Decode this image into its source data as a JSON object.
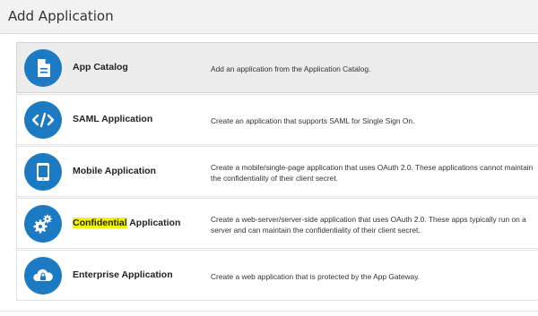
{
  "dialog": {
    "title": "Add Application"
  },
  "colors": {
    "icon_background": "#1b7ac2",
    "highlight": "#f4f400",
    "selected_row": "#ececec"
  },
  "applications": [
    {
      "title": "App Catalog",
      "description": "Add an application from the Application Catalog.",
      "icon": "document-icon",
      "selected": true
    },
    {
      "title": "SAML Application",
      "description": "Create an application that supports SAML for Single Sign On.",
      "icon": "code-icon",
      "selected": false
    },
    {
      "title": "Mobile Application",
      "description": "Create a mobile/single-page application that uses OAuth 2.0. These applications cannot maintain the confidentiality of their client secret.",
      "icon": "tablet-icon",
      "selected": false
    },
    {
      "title_highlight": "Confidential",
      "title_rest": " Application",
      "description": "Create a web-server/server-side application that uses OAuth 2.0. These apps typically run on a server and can maintain the confidentiality of their client secret.",
      "icon": "gears-icon",
      "selected": false
    },
    {
      "title": "Enterprise Application",
      "description": "Create a web application that is protected by the App Gateway.",
      "icon": "cloud-icon",
      "selected": false
    }
  ]
}
